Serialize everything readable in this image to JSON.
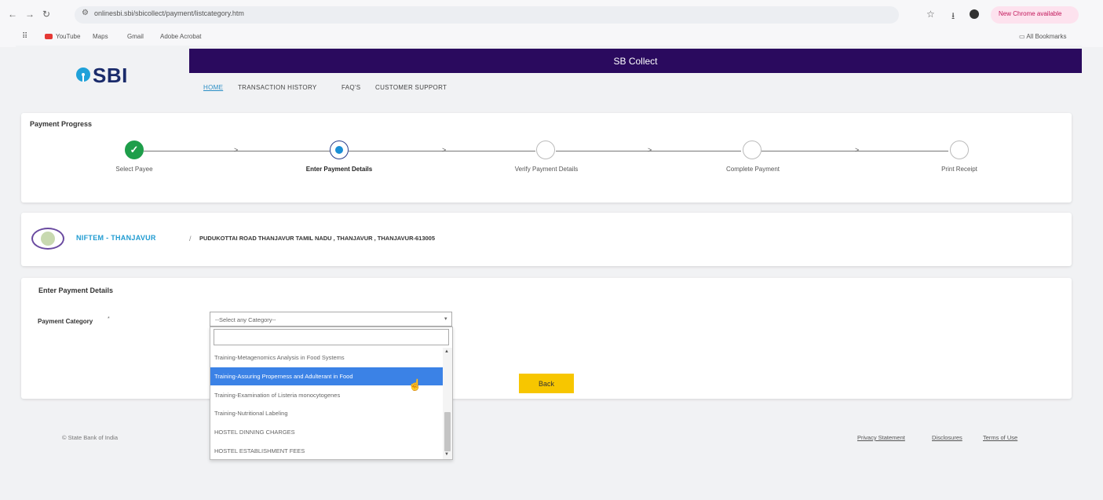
{
  "browser": {
    "url": "onlinesbi.sbi/sbicollect/payment/listcategory.htm",
    "update_chip": "New Chrome available",
    "bookmarks": [
      "YouTube",
      "Maps",
      "Gmail",
      "Adobe Acrobat"
    ],
    "all_bookmarks": "All Bookmarks"
  },
  "header": {
    "logo": "SBI",
    "banner_title": "SB Collect",
    "nav": [
      "HOME",
      "TRANSACTION HISTORY",
      "FAQ'S",
      "CUSTOMER SUPPORT"
    ]
  },
  "progress": {
    "title": "Payment Progress",
    "steps": [
      "Select Payee",
      "Enter Payment Details",
      "Verify Payment Details",
      "Complete Payment",
      "Print Receipt"
    ],
    "current_step": 2
  },
  "entity": {
    "name": "NIFTEM - THANJAVUR",
    "separator": "/",
    "address": "PUDUKOTTAI ROAD THANJAVUR TAMIL NADU , THANJAVUR , THANJAVUR-613005"
  },
  "payment_details": {
    "title": "Enter Payment Details",
    "category_label": "Payment Category",
    "category_required_mark": "*",
    "select_value": "--Select any Category--",
    "search_value": "",
    "options": [
      "Training-Metagenomics Analysis in Food Systems",
      "Training-Assuring Properness and Adulterant in Food",
      "Training-Examination of Listeria monocytogenes",
      "Training-Nutritional Labeling",
      "HOSTEL DINNING CHARGES",
      "HOSTEL ESTABLISHMENT FEES"
    ],
    "highlighted_option": 1,
    "back_label": "Back"
  },
  "footer": {
    "copyright": "© State Bank of India",
    "links": [
      "Privacy Statement",
      "Disclosures",
      "Terms of Use"
    ]
  },
  "colors": {
    "banner": "#2a0a5e",
    "accent": "#1f9bd1",
    "back_button": "#f7c600",
    "highlight": "#3b82e6",
    "done_step": "#1e9e4a"
  }
}
